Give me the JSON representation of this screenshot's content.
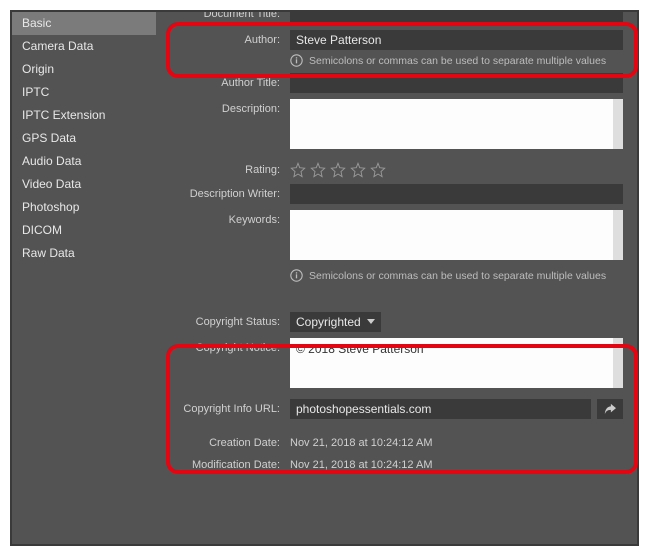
{
  "sidebar": {
    "items": [
      {
        "label": "Basic"
      },
      {
        "label": "Camera Data"
      },
      {
        "label": "Origin"
      },
      {
        "label": "IPTC"
      },
      {
        "label": "IPTC Extension"
      },
      {
        "label": "GPS Data"
      },
      {
        "label": "Audio Data"
      },
      {
        "label": "Video Data"
      },
      {
        "label": "Photoshop"
      },
      {
        "label": "DICOM"
      },
      {
        "label": "Raw Data"
      }
    ]
  },
  "labels": {
    "doc_title": "Document Title:",
    "author": "Author:",
    "author_title": "Author Title:",
    "description": "Description:",
    "rating": "Rating:",
    "desc_writer": "Description Writer:",
    "keywords": "Keywords:",
    "copy_status": "Copyright Status:",
    "copy_notice": "Copyright Notice:",
    "copy_url": "Copyright Info URL:",
    "created": "Creation Date:",
    "modified": "Modification Date:"
  },
  "values": {
    "doc_title": "",
    "author": "Steve Patterson",
    "author_title": "",
    "description": "",
    "desc_writer": "",
    "keywords": "",
    "copy_status": "Copyrighted",
    "copy_notice": "© 2018 Steve Patterson",
    "copy_url": "photoshopessentials.com",
    "created": "Nov 21, 2018 at 10:24:12 AM",
    "modified": "Nov 21, 2018 at 10:24:12 AM"
  },
  "hints": {
    "multi": "Semicolons or commas can be used to separate multiple values"
  },
  "rating": 0
}
